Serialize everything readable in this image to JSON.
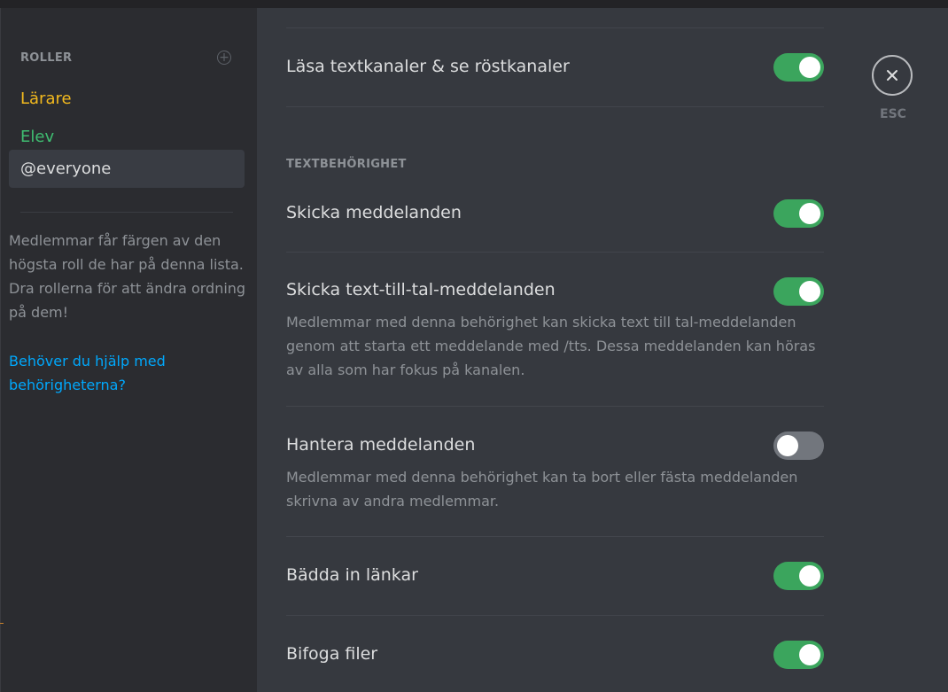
{
  "sidebar": {
    "roles_title": "ROLLER",
    "roles": [
      {
        "label": "Lärare",
        "color": "#f2b91e"
      },
      {
        "label": "Elev",
        "color": "#3fbd71"
      },
      {
        "label": "@everyone",
        "color": "#dcddde",
        "selected": true
      }
    ],
    "info_text": "Medlemmar får färgen av den högsta roll de har på denna lista. Dra rollerna för att ändra ordning på dem!",
    "help_link": "Behöver du hjälp med behörigheterna?"
  },
  "permissions": {
    "read": {
      "label": "Läsa textkanaler & se röstkanaler",
      "enabled": true
    },
    "section_text": "TEXTBEHÖRIGHET",
    "send": {
      "label": "Skicka meddelanden",
      "enabled": true
    },
    "tts": {
      "label": "Skicka text-till-tal-meddelanden",
      "description": "Medlemmar med denna behörighet kan skicka text till tal-meddelanden genom att starta ett meddelande med /tts. Dessa meddelanden kan höras av alla som har fokus på kanalen.",
      "enabled": true
    },
    "manage": {
      "label": "Hantera meddelanden",
      "description": "Medlemmar med denna behörighet kan ta bort eller fästa meddelanden skrivna av andra medlemmar.",
      "enabled": false
    },
    "embed": {
      "label": "Bädda in länkar",
      "enabled": true
    },
    "attach": {
      "label": "Bifoga filer",
      "enabled": true
    }
  },
  "close": {
    "label": "ESC",
    "icon": "close-icon"
  },
  "colors": {
    "toggle_on": "#3ba55d",
    "toggle_off": "#72767d",
    "link": "#00a8fc"
  }
}
